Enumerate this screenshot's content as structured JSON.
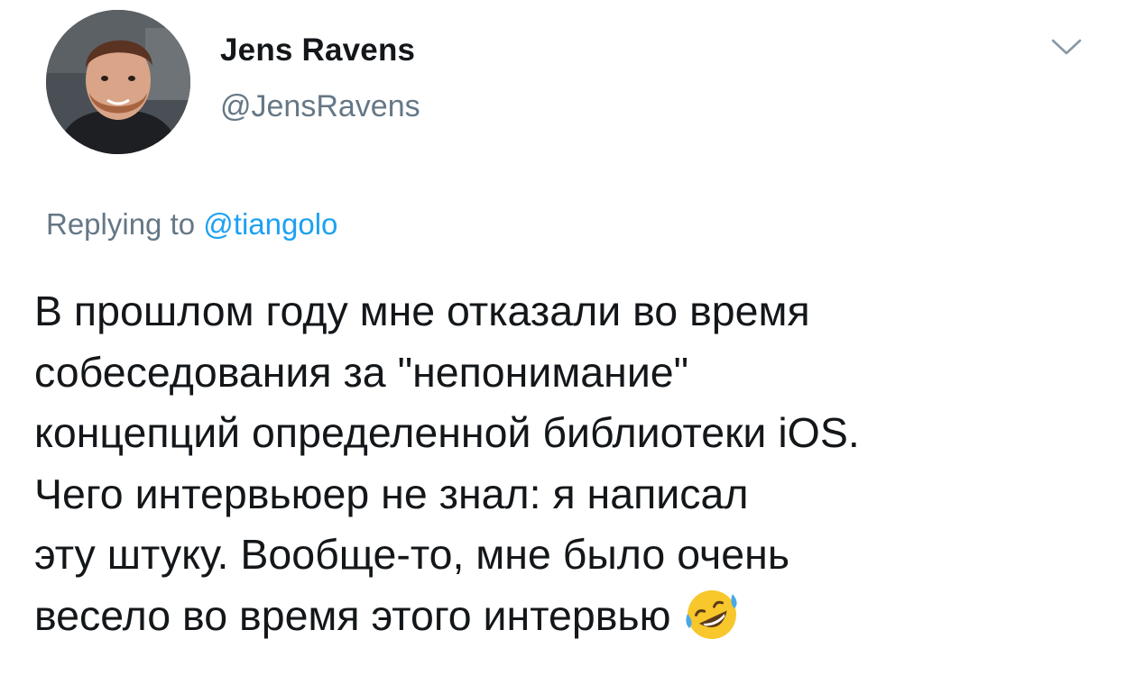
{
  "tweet": {
    "author": {
      "display_name": "Jens Ravens",
      "handle": "@JensRavens"
    },
    "reply": {
      "prefix": "Replying to",
      "target": "@tiangolo"
    },
    "text_lines": [
      "В прошлом году мне отказали во время",
      "собеседования за \"непонимание\"",
      "концепций определенной библиотеки iOS.",
      "Чего интервьюер не знал: я написал",
      "эту штуку. Вообще-то, мне было очень",
      "весело во время этого интервью"
    ],
    "emoji": "rolling-on-floor-laughing-emoji"
  },
  "colors": {
    "text": "#14171a",
    "secondary": "#657786",
    "link": "#1da1f2",
    "emoji_face": "#f7c72b"
  }
}
